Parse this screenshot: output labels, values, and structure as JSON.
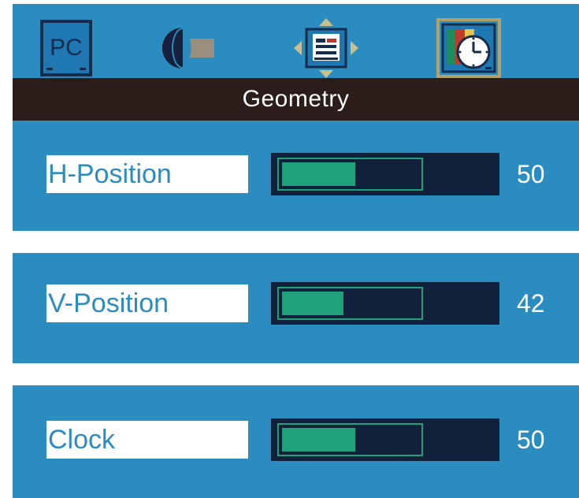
{
  "tabs": [
    {
      "name": "pc-tab",
      "icon": "pc-monitor-icon",
      "label": "PC"
    },
    {
      "name": "color-tab",
      "icon": "color-half-circle-icon"
    },
    {
      "name": "adjust-tab",
      "icon": "move-arrows-icon"
    },
    {
      "name": "geometry-tab",
      "icon": "clock-monitor-icon",
      "selected": true
    }
  ],
  "menu": {
    "title": "Geometry"
  },
  "settings": [
    {
      "label": "H-Position",
      "value": "50",
      "level": 0.5
    },
    {
      "label": "V-Position",
      "value": "42",
      "level": 0.42
    },
    {
      "label": "Clock",
      "value": "50",
      "level": 0.5
    }
  ],
  "colors": {
    "panel": "#2b8cc0",
    "title_bar": "#2b1d19",
    "slider_track": "#12213b",
    "slider_fill": "#1fa27b",
    "selected_tab_border": "#b4a16a"
  }
}
